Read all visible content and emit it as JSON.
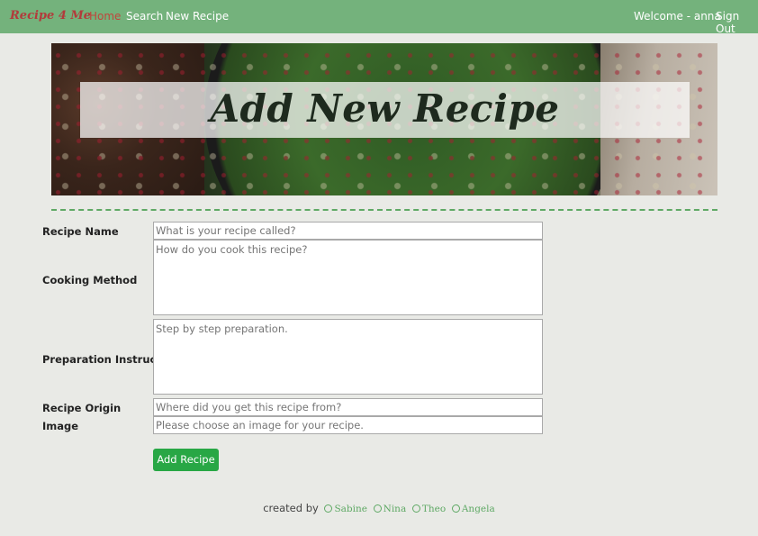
{
  "navbar": {
    "brand": "Recipe 4 Me",
    "links": [
      {
        "label": "Home",
        "active": true
      },
      {
        "label": "Search",
        "active": false
      },
      {
        "label": "New Recipe",
        "active": false
      }
    ],
    "welcome": "Welcome - anna",
    "sign_out": "Sign Out"
  },
  "hero": {
    "title": "Add New Recipe"
  },
  "form": {
    "recipe_name": {
      "label": "Recipe Name",
      "placeholder": "What is your recipe called?"
    },
    "cooking_method": {
      "label": "Cooking Method",
      "placeholder": "How do you cook this recipe?"
    },
    "preparation": {
      "label": "Preparation Instructions",
      "placeholder": "Step by step preparation."
    },
    "origin": {
      "label": "Recipe Origin",
      "placeholder": "Where did you get this recipe from?"
    },
    "image": {
      "label": "Image",
      "placeholder": "Please choose an image for your recipe."
    },
    "submit_label": "Add Recipe"
  },
  "footer": {
    "prefix": "created by",
    "authors": [
      "Sabine",
      "Nina",
      "Theo",
      "Angela"
    ]
  },
  "colors": {
    "navbar": "#74b27c",
    "brand": "#b23b3b",
    "active_link": "#c0463c",
    "button": "#28a745",
    "accent_green": "#5fa965"
  }
}
